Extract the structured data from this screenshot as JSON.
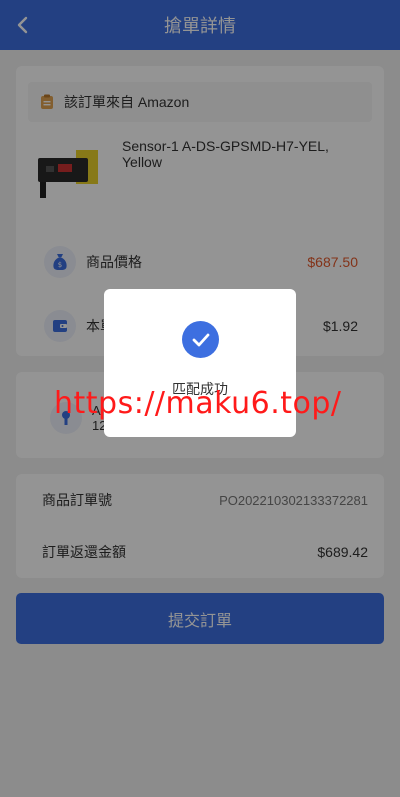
{
  "header": {
    "title": "搶單詳情"
  },
  "order": {
    "source_label": "該訂單來自 Amazon",
    "product_name": "Sensor-1 A-DS-GPSMD-H7-YEL, Yellow",
    "price_label": "商品價格",
    "price_value": "$687.50",
    "commission_label": "本單",
    "commission_value": "$1.92",
    "mid_label": "A",
    "mid_sub": "12"
  },
  "info": {
    "order_no_label": "商品訂單號",
    "order_no_value": "PO202210302133372281",
    "refund_label": "訂單返還金額",
    "refund_value": "$689.42"
  },
  "submit": {
    "label": "提交訂單"
  },
  "modal": {
    "message": "匹配成功"
  },
  "watermark": {
    "text": "https://maku6.top/"
  },
  "colors": {
    "primary": "#3d6fe0",
    "price": "#e2592b",
    "watermark": "#ff1a1a"
  }
}
